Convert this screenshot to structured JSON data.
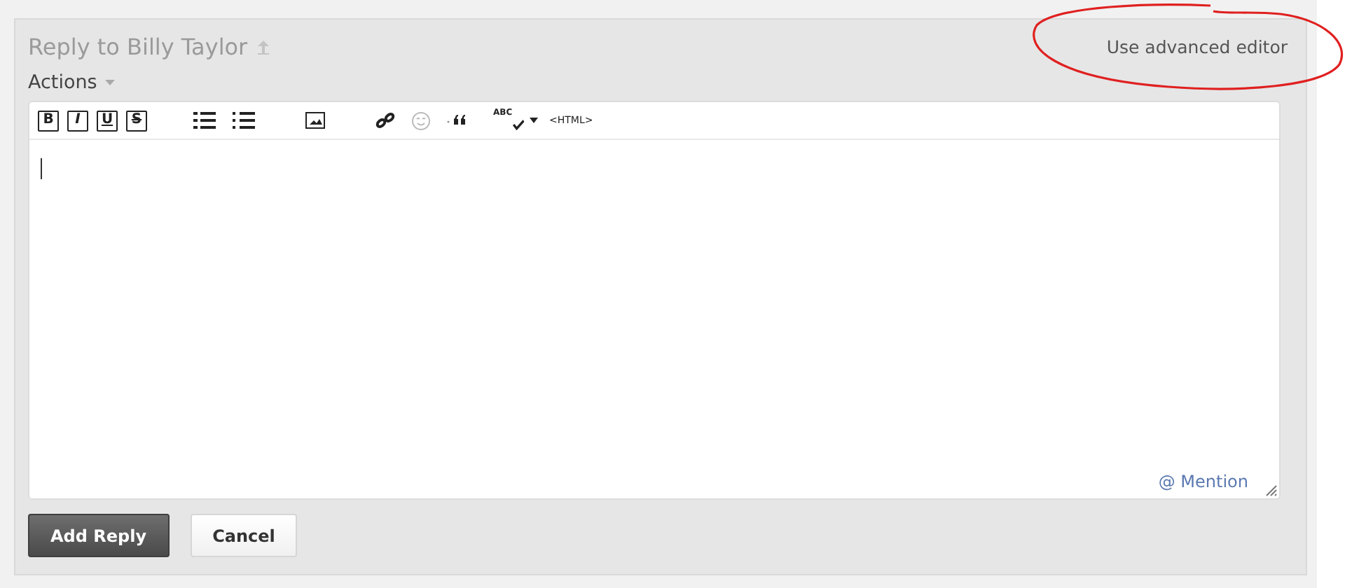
{
  "header": {
    "title": "Reply to Billy Taylor",
    "advanced_link": "Use advanced editor"
  },
  "actions_menu": {
    "label": "Actions"
  },
  "toolbar": [
    {
      "kind": "bold",
      "label": "B"
    },
    {
      "kind": "italic",
      "label": "I"
    },
    {
      "kind": "underline",
      "label": "U"
    },
    {
      "kind": "strike",
      "label": "S"
    },
    {
      "kind": "gap"
    },
    {
      "kind": "bullets"
    },
    {
      "kind": "numbers"
    },
    {
      "kind": "gap"
    },
    {
      "kind": "image"
    },
    {
      "kind": "gap"
    },
    {
      "kind": "link"
    },
    {
      "kind": "smiley"
    },
    {
      "kind": "quote"
    },
    {
      "kind": "spell",
      "label": "ABC"
    },
    {
      "kind": "html",
      "label": "<HTML>"
    }
  ],
  "editor": {
    "mention": "@ Mention"
  },
  "buttons": [
    {
      "label": "Add Reply",
      "kind": "primary"
    },
    {
      "label": "Cancel",
      "kind": "secondary"
    }
  ]
}
